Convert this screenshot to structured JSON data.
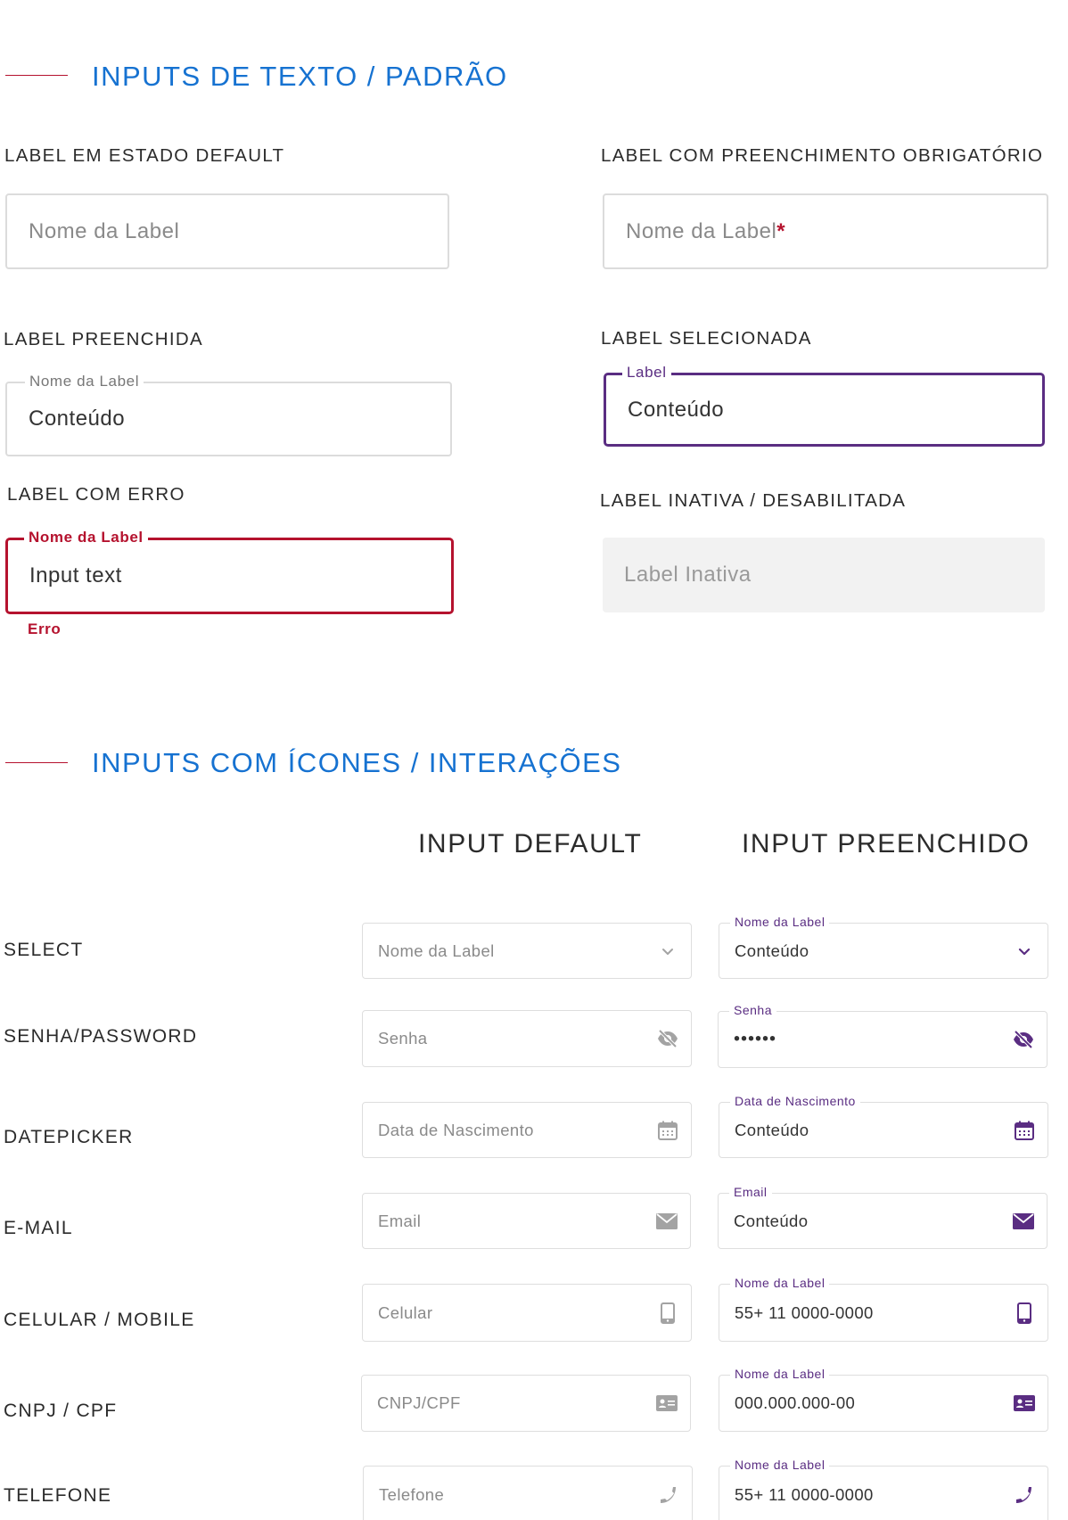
{
  "sections": {
    "text_inputs_title": "INPUTS DE TEXTO / PADRÃO",
    "icon_inputs_title": "INPUTS COM ÍCONES / INTERAÇÕES"
  },
  "states": {
    "default": {
      "caption": "LABEL EM ESTADO DEFAULT",
      "placeholder": "Nome da Label"
    },
    "required": {
      "caption": "LABEL COM PREENCHIMENTO OBRIGATÓRIO",
      "placeholder": "Nome da Label",
      "asterisk": "*"
    },
    "filled": {
      "caption": "LABEL PREENCHIDA",
      "label": "Nome da Label",
      "value": "Conteúdo"
    },
    "selected": {
      "caption": "LABEL SELECIONADA",
      "label": "Label",
      "value": "Conteúdo"
    },
    "error": {
      "caption": "LABEL COM ERRO",
      "label": "Nome da Label",
      "value": "Input text",
      "message": "Erro"
    },
    "disabled": {
      "caption": "LABEL INATIVA / DESABILITADA",
      "placeholder": "Label Inativa"
    }
  },
  "columns": {
    "default": "INPUT DEFAULT",
    "filled": "INPUT PREENCHIDO"
  },
  "rows": [
    {
      "label": "SELECT",
      "placeholder": "Nome da Label",
      "filled_label": "Nome da Label",
      "filled_value": "Conteúdo",
      "icon": "chevron-down-icon"
    },
    {
      "label": "SENHA/PASSWORD",
      "placeholder": "Senha",
      "filled_label": "Senha",
      "filled_value": "••••••",
      "icon": "eye-off-icon"
    },
    {
      "label": "DATEPICKER",
      "placeholder": "Data de Nascimento",
      "filled_label": "Data de Nascimento",
      "filled_value": "Conteúdo",
      "icon": "calendar-icon"
    },
    {
      "label": "E-MAIL",
      "placeholder": "Email",
      "filled_label": "Email",
      "filled_value": "Conteúdo",
      "icon": "mail-icon"
    },
    {
      "label": "CELULAR / MOBILE",
      "placeholder": "Celular",
      "filled_label": "Nome da Label",
      "filled_value": "55+ 11 0000-0000",
      "icon": "mobile-icon"
    },
    {
      "label": "CNPJ / CPF",
      "placeholder": "CNPJ/CPF",
      "filled_label": "Nome da Label",
      "filled_value": "000.000.000-00",
      "icon": "id-card-icon"
    },
    {
      "label": "TELEFONE",
      "placeholder": "Telefone",
      "filled_label": "Nome da Label",
      "filled_value": "55+ 11 0000-0000",
      "icon": "phone-icon"
    }
  ],
  "colors": {
    "accent_blue": "#1672d1",
    "brand_red": "#b5122e",
    "brand_purple": "#5a2d82",
    "icon_gray": "#a3a3a3",
    "disabled_bg": "#f2f2f2"
  }
}
